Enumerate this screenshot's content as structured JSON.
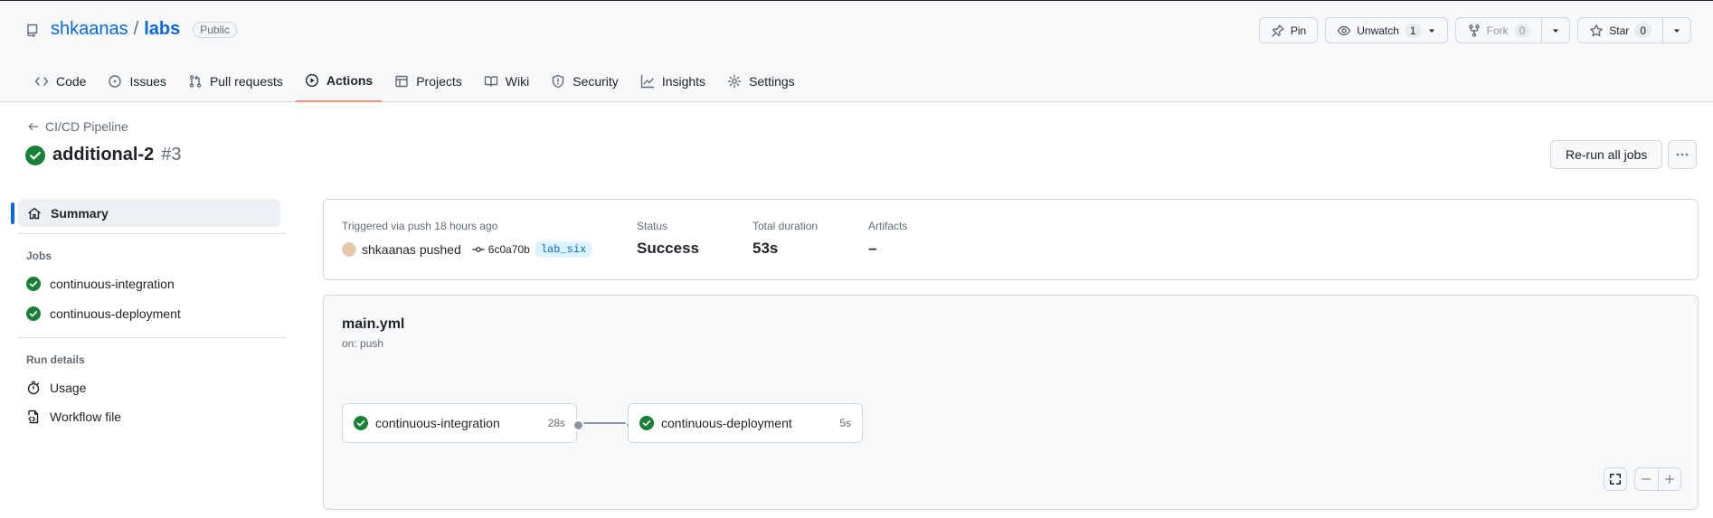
{
  "repo": {
    "owner": "shkaanas",
    "separator": "/",
    "name": "labs",
    "visibility": "Public"
  },
  "repo_actions": {
    "pin": "Pin",
    "unwatch": "Unwatch",
    "unwatch_count": "1",
    "fork": "Fork",
    "fork_count": "0",
    "star": "Star",
    "star_count": "0"
  },
  "tabs": [
    {
      "label": "Code",
      "icon": "code-icon"
    },
    {
      "label": "Issues",
      "icon": "issue-icon"
    },
    {
      "label": "Pull requests",
      "icon": "pull-request-icon"
    },
    {
      "label": "Actions",
      "icon": "play-icon",
      "active": true
    },
    {
      "label": "Projects",
      "icon": "table-icon"
    },
    {
      "label": "Wiki",
      "icon": "book-icon"
    },
    {
      "label": "Security",
      "icon": "shield-icon"
    },
    {
      "label": "Insights",
      "icon": "graph-icon"
    },
    {
      "label": "Settings",
      "icon": "gear-icon"
    }
  ],
  "run": {
    "back_label": "CI/CD Pipeline",
    "title": "additional-2",
    "number": "#3",
    "rerun_label": "Re-run all jobs"
  },
  "sidebar": {
    "summary": "Summary",
    "jobs_heading": "Jobs",
    "jobs": [
      "continuous-integration",
      "continuous-deployment"
    ],
    "details_heading": "Run details",
    "usage": "Usage",
    "workflow_file": "Workflow file"
  },
  "summary_card": {
    "trigger_text": "Triggered via push 18 hours ago",
    "actor": "shkaanas pushed",
    "sha": "6c0a70b",
    "branch": "lab_six",
    "status_label": "Status",
    "status_value": "Success",
    "duration_label": "Total duration",
    "duration_value": "53s",
    "artifacts_label": "Artifacts",
    "artifacts_value": "–"
  },
  "workflow": {
    "file": "main.yml",
    "trigger": "on: push",
    "jobs": [
      {
        "name": "continuous-integration",
        "duration": "28s"
      },
      {
        "name": "continuous-deployment",
        "duration": "5s"
      }
    ]
  },
  "colors": {
    "accent": "#0969da",
    "success": "#1a7f37",
    "tab_underline": "#fd8c73"
  }
}
